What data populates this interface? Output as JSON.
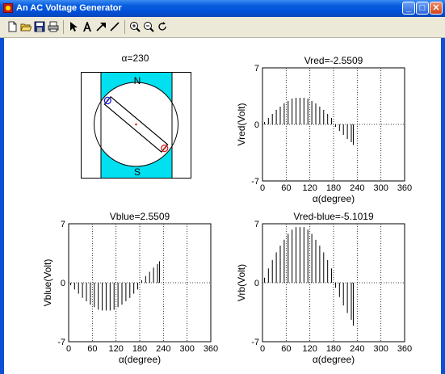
{
  "window": {
    "title": "An AC Voltage Generator",
    "buttons": {
      "minimize": "_",
      "maximize": "□",
      "close": "✕"
    }
  },
  "toolbar": {
    "tools": [
      "new-file-icon",
      "open-folder-icon",
      "save-icon",
      "print-icon",
      "select-arrow-icon",
      "text-icon",
      "arrow-icon",
      "line-icon",
      "zoom-in-icon",
      "zoom-out-icon",
      "rotate-icon"
    ]
  },
  "generator": {
    "title": "α=230",
    "pole_north": "N",
    "pole_south": "S",
    "angle_deg": 230,
    "colors": {
      "pole": "#00e0f0",
      "red": "#e02020",
      "blue": "#2020e0"
    }
  },
  "plots": {
    "xlabel": "α(degree)",
    "xticks": [
      "0",
      "60",
      "120",
      "180",
      "240",
      "300",
      "360"
    ],
    "yticks": [
      "7",
      "0",
      "-7"
    ],
    "vred": {
      "title": "Vred=-2.5509",
      "ylabel": "Vred(Volt)"
    },
    "vblue": {
      "title": "Vblue=2.5509",
      "ylabel": "Vblue(Volt)"
    },
    "vrb": {
      "title": "Vred-blue=-5.1019",
      "ylabel": "Vrb(Volt)"
    }
  },
  "chart_data": [
    {
      "type": "bar",
      "title": "Vred=-2.5509",
      "xlabel": "α(degree)",
      "ylabel": "Vred(Volt)",
      "xlim": [
        0,
        360
      ],
      "ylim": [
        -7,
        7
      ],
      "grid": true,
      "x": [
        5,
        15,
        25,
        35,
        45,
        55,
        65,
        75,
        85,
        95,
        105,
        115,
        125,
        135,
        145,
        155,
        165,
        175,
        185,
        195,
        205,
        215,
        225,
        230
      ],
      "values": [
        0.3,
        0.8,
        1.3,
        1.8,
        2.2,
        2.6,
        2.9,
        3.2,
        3.3,
        3.3,
        3.3,
        3.2,
        2.9,
        2.6,
        2.2,
        1.8,
        1.3,
        0.8,
        -0.3,
        -0.8,
        -1.3,
        -1.8,
        -2.2,
        -2.55
      ]
    },
    {
      "type": "bar",
      "title": "Vblue=2.5509",
      "xlabel": "α(degree)",
      "ylabel": "Vblue(Volt)",
      "xlim": [
        0,
        360
      ],
      "ylim": [
        -7,
        7
      ],
      "grid": true,
      "x": [
        5,
        15,
        25,
        35,
        45,
        55,
        65,
        75,
        85,
        95,
        105,
        115,
        125,
        135,
        145,
        155,
        165,
        175,
        185,
        195,
        205,
        215,
        225,
        230
      ],
      "values": [
        -0.3,
        -0.8,
        -1.3,
        -1.8,
        -2.2,
        -2.6,
        -2.9,
        -3.2,
        -3.3,
        -3.3,
        -3.3,
        -3.2,
        -2.9,
        -2.6,
        -2.2,
        -1.8,
        -1.3,
        -0.8,
        0.3,
        0.8,
        1.3,
        1.8,
        2.2,
        2.55
      ]
    },
    {
      "type": "bar",
      "title": "Vred-blue=-5.1019",
      "xlabel": "α(degree)",
      "ylabel": "Vrb(Volt)",
      "xlim": [
        0,
        360
      ],
      "ylim": [
        -7,
        7
      ],
      "grid": true,
      "x": [
        5,
        15,
        25,
        35,
        45,
        55,
        65,
        75,
        85,
        95,
        105,
        115,
        125,
        135,
        145,
        155,
        165,
        175,
        185,
        195,
        205,
        215,
        225,
        230
      ],
      "values": [
        0.6,
        1.7,
        2.7,
        3.6,
        4.4,
        5.1,
        5.8,
        6.3,
        6.6,
        6.6,
        6.6,
        6.3,
        5.8,
        5.1,
        4.4,
        3.6,
        2.7,
        1.7,
        -0.6,
        -1.7,
        -2.7,
        -3.6,
        -4.4,
        -5.1
      ]
    }
  ]
}
